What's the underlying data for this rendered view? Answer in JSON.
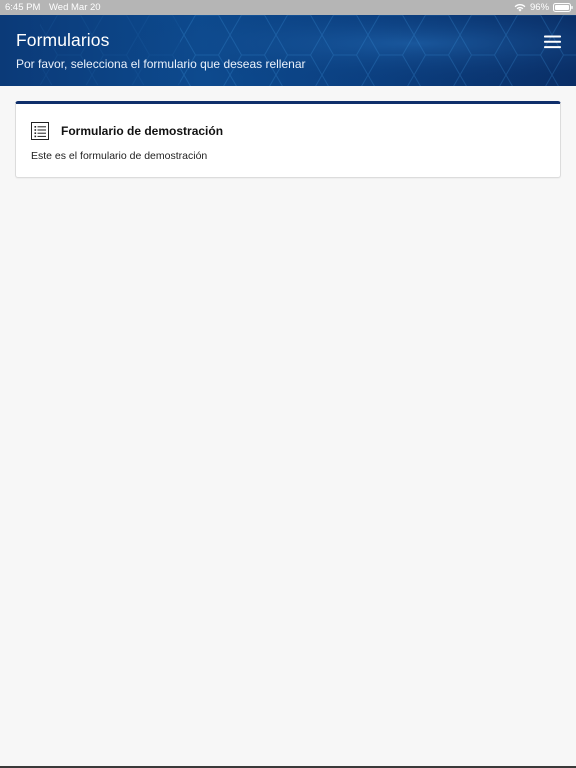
{
  "status_bar": {
    "time": "6:45 PM",
    "date": "Wed Mar 20",
    "battery": "96%"
  },
  "header": {
    "title": "Formularios",
    "subtitle": "Por favor, selecciona el formulario que deseas rellenar",
    "menu_icon": "hamburger-menu-icon",
    "accent_color": "#0b3a78"
  },
  "forms": [
    {
      "title": "Formulario de demostración",
      "description": "Este es el formulario de demostración",
      "icon": "list-icon",
      "accent_color": "#0f2f6b"
    }
  ]
}
